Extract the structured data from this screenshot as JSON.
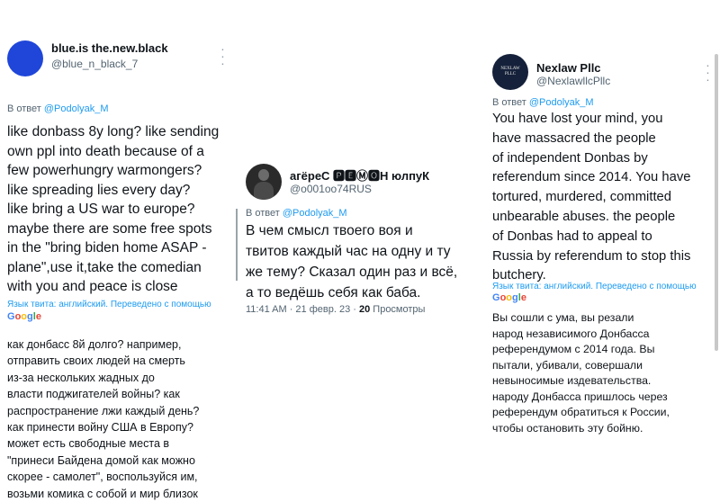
{
  "tweets": [
    {
      "name": "blue.is the.new.black",
      "handle": "@blue_n_black_7",
      "reply_prefix": "В ответ ",
      "reply_to": "@Podolyak_M",
      "text": "like donbass 8y long? like sending\nown ppl into death because of a\nfew powerhungry warmongers?\nlike spreading lies every day?\nlike bring a US war to europe?\nmaybe there are some free spots\nin the \"bring biden home ASAP -\nplane\",use it,take the comedian\nwith you and peace is close",
      "translation_note": "Язык твита: английский. Переведено с помощью",
      "translation": "как донбасс 8й долго? например,\nотправить своих людей на смерть\nиз-за нескольких жадных до\nвласти поджигателей войны? как\nраспространение лжи каждый день?\nкак принести войну США в Европу?\nможет есть свободные места в\n\"принеси Байдена домой как можно\nскорее - самолет\", воспользуйся им,\nвозьми комика с собой и мир близок",
      "avatar_color": "#1f46d9"
    },
    {
      "name": "агёреС 🅿🅴Ⓜ🅾Н юлпуК",
      "handle": "@o001oo74RUS",
      "reply_prefix": "В ответ ",
      "reply_to": "@Podolyak_M",
      "text": "В чем смысл твоего воя и\nтвитов каждый час на одну и ту\nже тему? Сказал один раз и всё,\nа то ведёшь себя как баба.",
      "time": "11:41 AM · 21 февр. 23 · ",
      "views_count": "20",
      "views_label": " Просмотры"
    },
    {
      "name": "Nexlaw Pllc",
      "handle": "@NexlawllcPllc",
      "avatar_text": "NEXLAW PLLC",
      "reply_prefix": "В ответ ",
      "reply_to": "@Podolyak_M",
      "text": "You have lost your mind, you\nhave massacred the people\nof independent Donbas by\nreferendum since 2014. You have\ntortured, murdered, committed\nunbearable abuses. the people\nof Donbas had to appeal to\nRussia by referendum to stop this\nbutchery.",
      "translation_note": "Язык твита: английский. Переведено с помощью",
      "translation": "Вы сошли с ума, вы резали\nнарод независимого Донбасса\nреферендумом с 2014 года. Вы\nпытали, убивали, совершали\nневыносимые издевательства.\nнароду Донбасса пришлось через\nреферендум обратиться к России,\nчтобы остановить эту бойню."
    }
  ],
  "google_logo": "Google",
  "more_icon": "vertical-ellipsis",
  "colors": {
    "link": "#1d9bf0",
    "secondary": "#536471",
    "text": "#0f1419"
  }
}
